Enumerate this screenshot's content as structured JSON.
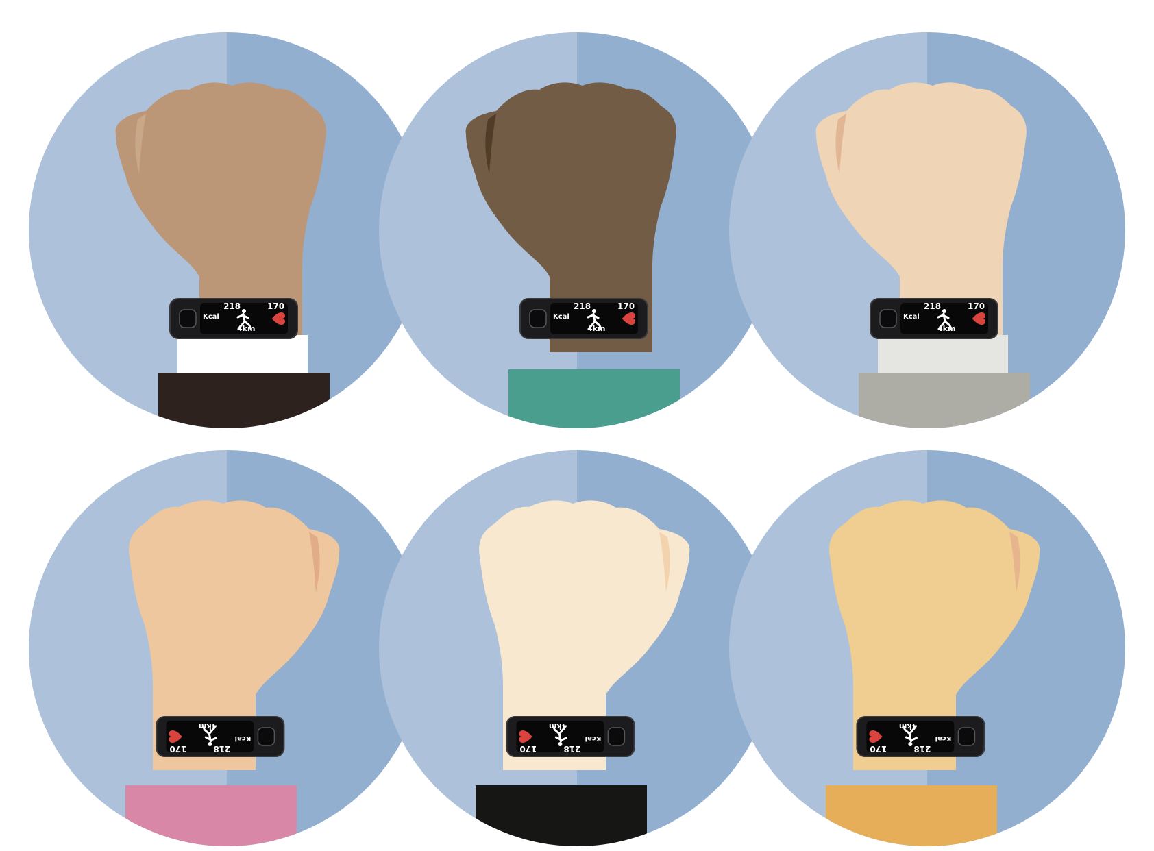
{
  "colors": {
    "background": "#ffffff",
    "circle_light": "#adc2da",
    "circle_dark": "#92afd0",
    "band": "#1c1c1e",
    "band_edge": "#3a3a3d",
    "screen": "#080808",
    "heart": "#d9443f"
  },
  "tracker": {
    "heart_rate": "170",
    "distance": "4km",
    "calories_label": "Kcal",
    "calories": "218",
    "heart_icon": "heart-icon",
    "activity_icon": "running-figure-icon"
  },
  "wrists": [
    {
      "id": "top-left",
      "skin": "#bc9777",
      "skin_shade": "#caa98b",
      "sleeve": "#2d221e",
      "cuff": "#ffffff",
      "band_flipped": false
    },
    {
      "id": "top-middle",
      "skin": "#735c45",
      "skin_shade": "#4e3825",
      "sleeve": "#4a9e8e",
      "cuff": null,
      "band_flipped": false
    },
    {
      "id": "top-right",
      "skin": "#efd5b5",
      "skin_shade": "#dfb390",
      "sleeve": "#adada6",
      "cuff": "#e5e5e1",
      "band_flipped": false
    },
    {
      "id": "bottom-left",
      "skin": "#eec79e",
      "skin_shade": "#e0a886",
      "sleeve": "#d987a7",
      "cuff": null,
      "band_flipped": true
    },
    {
      "id": "bottom-middle",
      "skin": "#f8e8d0",
      "skin_shade": "#f2cfaa",
      "sleeve": "#161615",
      "cuff": null,
      "band_flipped": true
    },
    {
      "id": "bottom-right",
      "skin": "#f0cd91",
      "skin_shade": "#e5b38d",
      "sleeve": "#e6ae59",
      "cuff": null,
      "band_flipped": true
    }
  ]
}
